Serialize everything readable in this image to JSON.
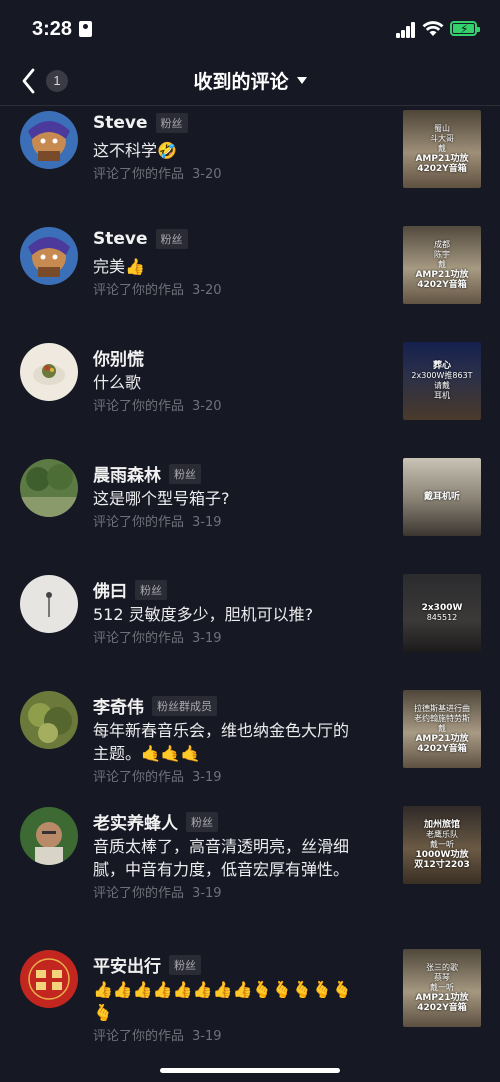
{
  "status_bar": {
    "time": "3:28"
  },
  "nav": {
    "back_count": "1",
    "title": "收到的评论"
  },
  "comments": [
    {
      "name": "Steve",
      "badge": "粉丝",
      "text": "这不科学🤣",
      "action": "评论了你的作品",
      "date": "3-20",
      "thumb": [
        "蜀山",
        "斗大哥",
        "戴",
        "AMP21功放",
        "4202Y音箱"
      ]
    },
    {
      "name": "Steve",
      "badge": "粉丝",
      "text": "完美👍",
      "action": "评论了你的作品",
      "date": "3-20",
      "thumb": [
        "成都",
        "陈宇",
        "戴",
        "AMP21功放",
        "4202Y音箱"
      ]
    },
    {
      "name": "你别慌",
      "badge": "",
      "text": "什么歌",
      "action": "评论了你的作品",
      "date": "3-20",
      "thumb": [
        "葬心",
        "2x300W推863T",
        "请戴",
        "耳机"
      ]
    },
    {
      "name": "晨雨森林",
      "badge": "粉丝",
      "text": "这是哪个型号箱子?",
      "action": "评论了你的作品",
      "date": "3-19",
      "thumb": [
        "戴耳机听"
      ]
    },
    {
      "name": "佛曰",
      "badge": "粉丝",
      "text": "512 灵敏度多少，胆机可以推?",
      "action": "评论了你的作品",
      "date": "3-19",
      "thumb": [
        "2x300W",
        "845512"
      ]
    },
    {
      "name": "李奇伟",
      "badge": "粉丝群成员",
      "text": "每年新春音乐会，维也纳金色大厅的主题。🤙🤙🤙",
      "action": "评论了你的作品",
      "date": "3-19",
      "thumb": [
        "拉德斯基进行曲",
        "老约翰施特劳斯",
        "戴",
        "AMP21功放",
        "4202Y音箱"
      ]
    },
    {
      "name": "老实养蜂人",
      "badge": "粉丝",
      "text": "音质太棒了，高音清透明亮，丝滑细腻，中音有力度，低音宏厚有弹性。",
      "action": "评论了你的作品",
      "date": "3-19",
      "thumb": [
        "加州旅馆",
        "老鹰乐队",
        "戴一听",
        "1000W功放",
        "双12寸2203"
      ]
    },
    {
      "name": "平安出行",
      "badge": "粉丝",
      "text": "👍👍👍👍👍👍👍👍🫰🫰🫰🫰🫰🫰",
      "action": "评论了你的作品",
      "date": "3-19",
      "thumb": [
        "张三的歌",
        "蔡琴",
        "戴一听",
        "AMP21功放",
        "4202Y音箱"
      ]
    }
  ]
}
